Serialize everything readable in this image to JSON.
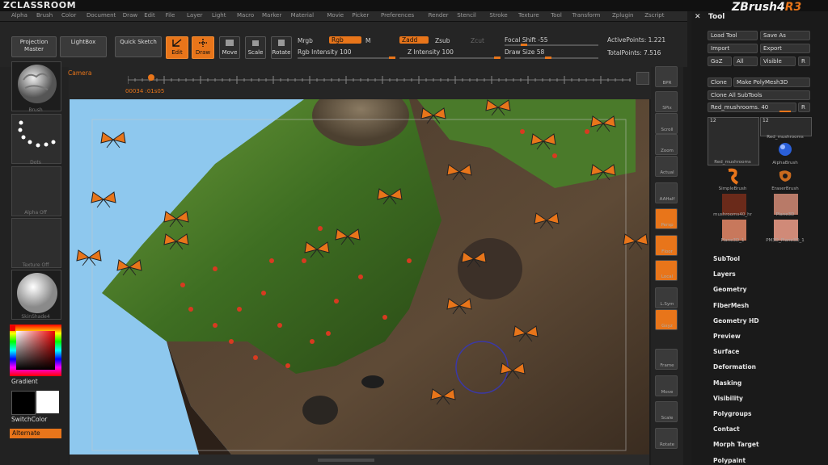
{
  "app": {
    "brand": "ZCLASSROOM",
    "logo_main": "ZBrush4",
    "logo_suffix": "R3",
    "accent": "#e8751a"
  },
  "menu": [
    "Alpha",
    "Brush",
    "Color",
    "Document",
    "Draw",
    "Edit",
    "File",
    "Layer",
    "Light",
    "Macro",
    "Marker",
    "Material",
    "Movie",
    "Picker",
    "Preferences",
    "Render",
    "Stencil",
    "Stroke",
    "Texture",
    "Tool",
    "Transform",
    "Zplugin",
    "Zscript"
  ],
  "toolbar": {
    "projection_master": "Projection Master",
    "lightbox": "LightBox",
    "quick_sketch": "Quick Sketch",
    "edit": "Edit",
    "draw": "Draw",
    "move": "Move",
    "scale": "Scale",
    "rotate": "Rotate",
    "mrgb": "Mrgb",
    "rgb": "Rgb",
    "m": "M",
    "rgb_intensity_label": "Rgb Intensity 100",
    "zadd": "Zadd",
    "zsub": "Zsub",
    "zcut": "Zcut",
    "z_intensity_label": "Z Intensity 100",
    "focal_shift_label": "Focal Shift -55",
    "draw_size_label": "Draw Size 58",
    "active_points": "ActivePoints: 1.221",
    "total_points": "TotalPoints: 7.516"
  },
  "timeline": {
    "camera": "Camera",
    "counter": "00034 :01s05"
  },
  "left_shelf": {
    "brush_label": "Brush",
    "dots_label": "Dots",
    "alpha_label": "Alpha Off",
    "texture_label": "Texture Off",
    "material_label": "SkinShade4",
    "gradient": "Gradient",
    "switch_color": "SwitchColor",
    "alternate": "Alternate"
  },
  "right_shelf": [
    {
      "name": "bpr-button",
      "label": "BPR"
    },
    {
      "name": "spix-button",
      "label": "SPix"
    },
    {
      "name": "scroll-button",
      "label": "Scroll"
    },
    {
      "name": "zoom-button",
      "label": "Zoom"
    },
    {
      "name": "actual-button",
      "label": "Actual"
    },
    {
      "name": "aahalf-button",
      "label": "AAHalf"
    },
    {
      "name": "persp-button",
      "label": "Persp"
    },
    {
      "name": "floor-button",
      "label": "Floor"
    },
    {
      "name": "local-button",
      "label": "Local"
    },
    {
      "name": "lsym-button",
      "label": "L.Sym"
    },
    {
      "name": "xyz-button",
      "label": "Gxyz"
    },
    {
      "name": "frame-button",
      "label": "Frame"
    },
    {
      "name": "move-button",
      "label": "Move"
    },
    {
      "name": "scale-button",
      "label": "Scale"
    },
    {
      "name": "rotate-button",
      "label": "Rotate"
    }
  ],
  "tool_panel": {
    "title": "Tool",
    "load_tool": "Load Tool",
    "save_as": "Save As",
    "import": "Import",
    "export": "Export",
    "goz": "GoZ",
    "all": "All",
    "visible": "Visible",
    "r": "R",
    "clone": "Clone",
    "make_polymesh": "Make PolyMesh3D",
    "clone_all": "Clone All SubTools",
    "current_tool": "Red_mushrooms. 40",
    "tile_count_1": "12",
    "tile_count_2": "12",
    "tile_current": "Red_mushrooms",
    "tile_current2": "Red_mushrooms",
    "alpha_brush": "AlphaBrush",
    "simple_brush": "SimpleBrush",
    "eraser_brush": "EraserBrush",
    "mushroom_tile": "mushrooms40_hr",
    "plane3d": "Plane3D",
    "plane3d_1": "Plane3D_1",
    "pm3d_plane": "PM3D_Plane3D_1"
  },
  "sections": [
    "SubTool",
    "Layers",
    "Geometry",
    "FiberMesh",
    "Geometry HD",
    "Preview",
    "Surface",
    "Deformation",
    "Masking",
    "Visibility",
    "Polygroups",
    "Contact",
    "Morph Target",
    "Polypaint"
  ]
}
